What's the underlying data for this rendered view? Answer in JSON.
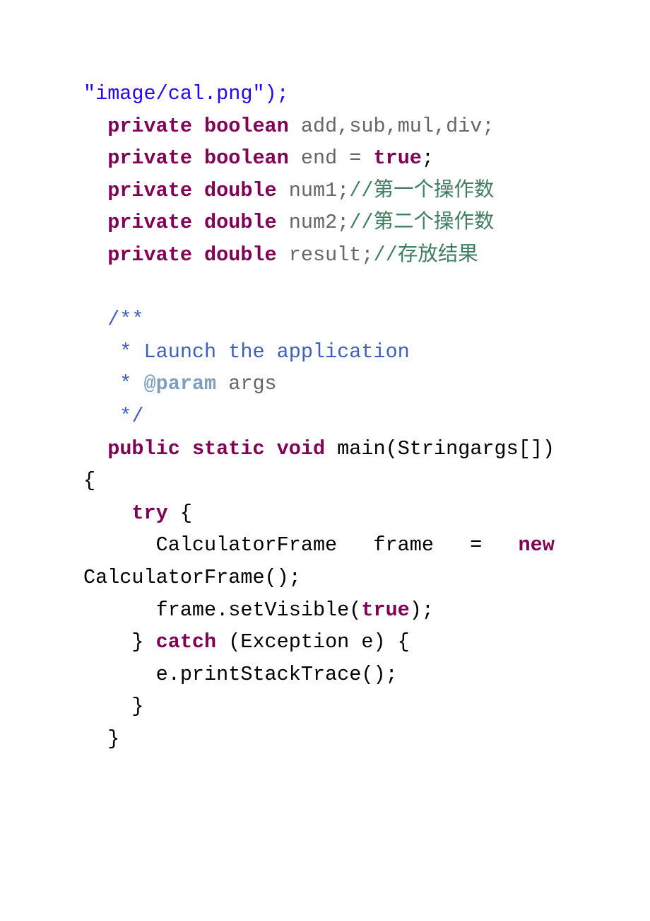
{
  "code": {
    "line1": "\"image/cal.png\");",
    "line2_kw": "private boolean",
    "line2_rest": " add,sub,mul,div;",
    "line3_kw1": "private boolean",
    "line3_mid": " end = ",
    "line3_kw2": "true",
    "line3_end": ";",
    "line4_kw": "private double",
    "line4_id": " num1;",
    "line4_cm": "//第一个操作数",
    "line5_kw": "private double",
    "line5_id": " num2;",
    "line5_cm": "//第二个操作数",
    "line6_kw": "private double",
    "line6_id": " result;",
    "line6_cm": "//存放结果",
    "jd1": "  /**",
    "jd2": "   * Launch the application",
    "jd3_pre": "   * ",
    "jd3_tag": "@param",
    "jd3_arg": " args",
    "jd4": "   */",
    "main_kw": "public static void",
    "main_sig_left": " main(String",
    "main_sig_right": "args[]) ",
    "brace_open": "{",
    "try_indent": "    ",
    "try_kw": "try",
    "try_rest": " {",
    "newline_left": "      CalculatorFrame",
    "newline_mid1": "frame",
    "newline_mid2": "=",
    "new_kw": "new",
    "ctor": "CalculatorFrame();",
    "setvis_pre": "      frame.setVisible(",
    "setvis_kw": "true",
    "setvis_end": ");",
    "catch_pre": "    } ",
    "catch_kw": "catch",
    "catch_rest": " (Exception e) {",
    "pst": "      e.printStackTrace();",
    "close1": "    }",
    "close2": "  }"
  }
}
